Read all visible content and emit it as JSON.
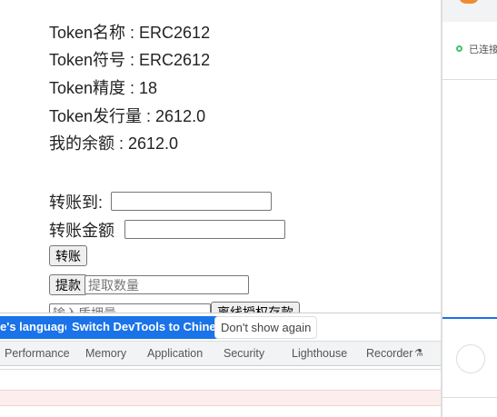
{
  "token": {
    "name": "Token名称 : ERC2612",
    "symbol": "Token符号 : ERC2612",
    "decimals": "Token精度 : 18",
    "supply": "Token发行量 : 2612.0",
    "balance": "我的余额 : 2612.0"
  },
  "transfer": {
    "to_label": "转账到:",
    "amount_label": "转账金额",
    "button": "转账"
  },
  "withdraw": {
    "button": "提款",
    "placeholder": "提取数量"
  },
  "deposit": {
    "placeholder": "输入质押量",
    "button": "离线授权存款"
  },
  "devtools": {
    "lang_button": "e's language",
    "switch_button": "Switch DevTools to Chinese",
    "dont_show": "Don't show again",
    "tabs": [
      "Performance",
      "Memory",
      "Application",
      "Security",
      "Lighthouse",
      "Recorder"
    ]
  },
  "wallet": {
    "status": "已连接",
    "status_color": "#3cc36a",
    "accent": "#1a73e8"
  }
}
